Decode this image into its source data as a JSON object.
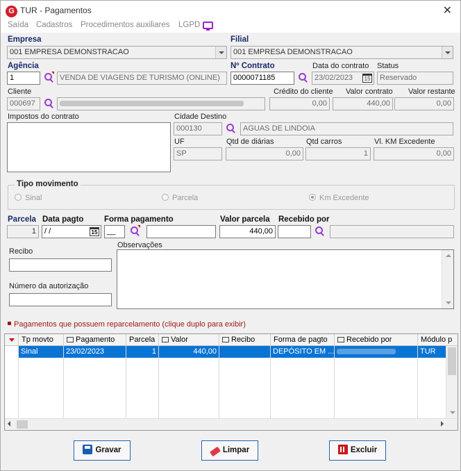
{
  "window": {
    "title": "TUR - Pagamentos",
    "logo": "G"
  },
  "menu": [
    "Saída",
    "Cadastros",
    "Procedimentos auxiliares",
    "LGPD"
  ],
  "labels": {
    "empresa": "Empresa",
    "filial": "Filial",
    "agencia": "Agência",
    "contrato": "Nº Contrato",
    "data_contrato": "Data do contrato",
    "status": "Status",
    "cliente": "Cliente",
    "credito": "Crédito do cliente",
    "valor_contrato": "Valor contrato",
    "valor_restante": "Valor restante",
    "impostos": "Impostos do contrato",
    "cidade_destino": "Cidade Destino",
    "uf": "UF",
    "qtd_diarias": "Qtd de diárias",
    "qtd_carros": "Qtd carros",
    "vl_km": "Vl. KM Excedente",
    "tipo_movimento": "Tipo movimento",
    "parcela": "Parcela",
    "data_pagto": "Data pagto",
    "forma_pagamento": "Forma pagamento",
    "valor_parcela": "Valor parcela",
    "recebido_por": "Recebido por",
    "recibo": "Recibo",
    "observacoes": "Observações",
    "numero_autorizacao": "Número da autorização"
  },
  "fields": {
    "empresa": "001 EMPRESA DEMONSTRACAO",
    "filial": "001 EMPRESA DEMONSTRACAO",
    "agencia_code": "1",
    "agencia_name": "VENDA DE VIAGENS DE TURISMO (ONLINE)",
    "contrato": "0000071185",
    "data_contrato": "23/02/2023",
    "status": "Reservado",
    "cliente_code": "000697",
    "credito": "0,00",
    "valor_contrato": "440,00",
    "valor_restante": "0,00",
    "cidade_code": "000130",
    "cidade_name": "AGUAS DE LINDOIA",
    "uf": "SP",
    "qtd_diarias": "0,00",
    "qtd_carros": "1",
    "vl_km": "0,00",
    "parcela": "1",
    "data_pagto": " / /",
    "forma_code": "__",
    "valor_parcela": "440,00",
    "calendar_glyph": "15"
  },
  "tipo_movimento": [
    "Sinal",
    "Parcela",
    "Km Excedente"
  ],
  "reparcelamento_note": "Pagamentos que possuem reparcelamento (clique duplo para exibir)",
  "grid": {
    "columns": [
      "Tp movto",
      "Pagamento",
      "Parcela",
      "Valor",
      "Recibo",
      "Forma de pagto",
      "Recebido por",
      "Módulo p"
    ],
    "rows": [
      {
        "tp": "Sinal",
        "pagamento": "23/02/2023",
        "parcela": "1",
        "valor": "440,00",
        "recibo": "",
        "forma": "DEPÓSITO EM ...",
        "recebido": "",
        "modulo": "TUR"
      }
    ]
  },
  "buttons": {
    "gravar": "Gravar",
    "limpar": "Limpar",
    "excluir": "Excluir"
  }
}
